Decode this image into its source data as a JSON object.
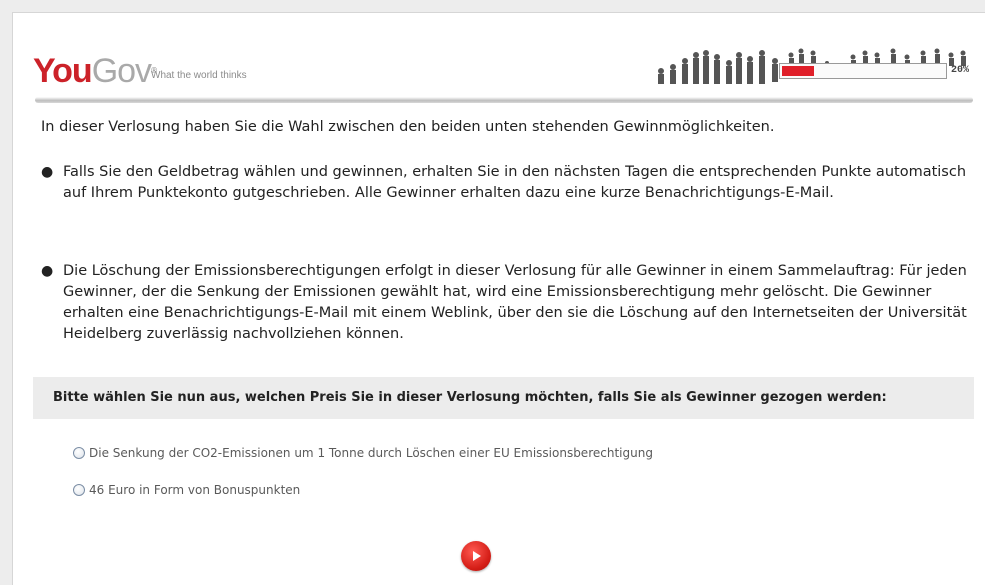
{
  "header": {
    "logo_you": "You",
    "logo_gov": "Gov",
    "tagline": "What the world thinks",
    "progress_percent": 20,
    "progress_label": "20%"
  },
  "content": {
    "intro": "In dieser Verlosung haben Sie die Wahl zwischen den beiden unten stehenden Gewinnmöglichkeiten.",
    "bullets": [
      "Falls Sie den Geldbetrag wählen und gewinnen, erhalten Sie in den nächsten Tagen die entsprechenden Punkte automatisch auf Ihrem Punktekonto gutgeschrieben. Alle Gewinner erhalten dazu eine kurze Benachrichtigungs-E-Mail.",
      "Die Löschung der Emissionsberechtigungen erfolgt in dieser Verlosung für alle Gewinner in einem Sammelauftrag: Für jeden Gewinner, der die Senkung der Emissionen gewählt hat, wird eine Emissionsberechtigung mehr gelöscht. Die Gewinner erhalten eine Benachrichtigungs-E-Mail mit einem Weblink, über den sie die Löschung auf den Internetseiten der Universität Heidelberg zuverlässig nachvollziehen können."
    ]
  },
  "question": {
    "text": "Bitte wählen Sie nun aus, welchen Preis Sie in dieser Verlosung möchten, falls Sie als Gewinner gezogen werden:",
    "options": [
      "Die Senkung der CO2-Emissionen um 1 Tonne durch Löschen einer EU Emissionsberechtigung",
      "46 Euro in Form von Bonuspunkten"
    ]
  },
  "icons": {
    "next": "play-arrow-icon",
    "crowd": "crowd-illustration"
  },
  "colors": {
    "brand_red": "#cc2229",
    "progress_fill": "#e0202a",
    "question_bg": "#ececec"
  }
}
